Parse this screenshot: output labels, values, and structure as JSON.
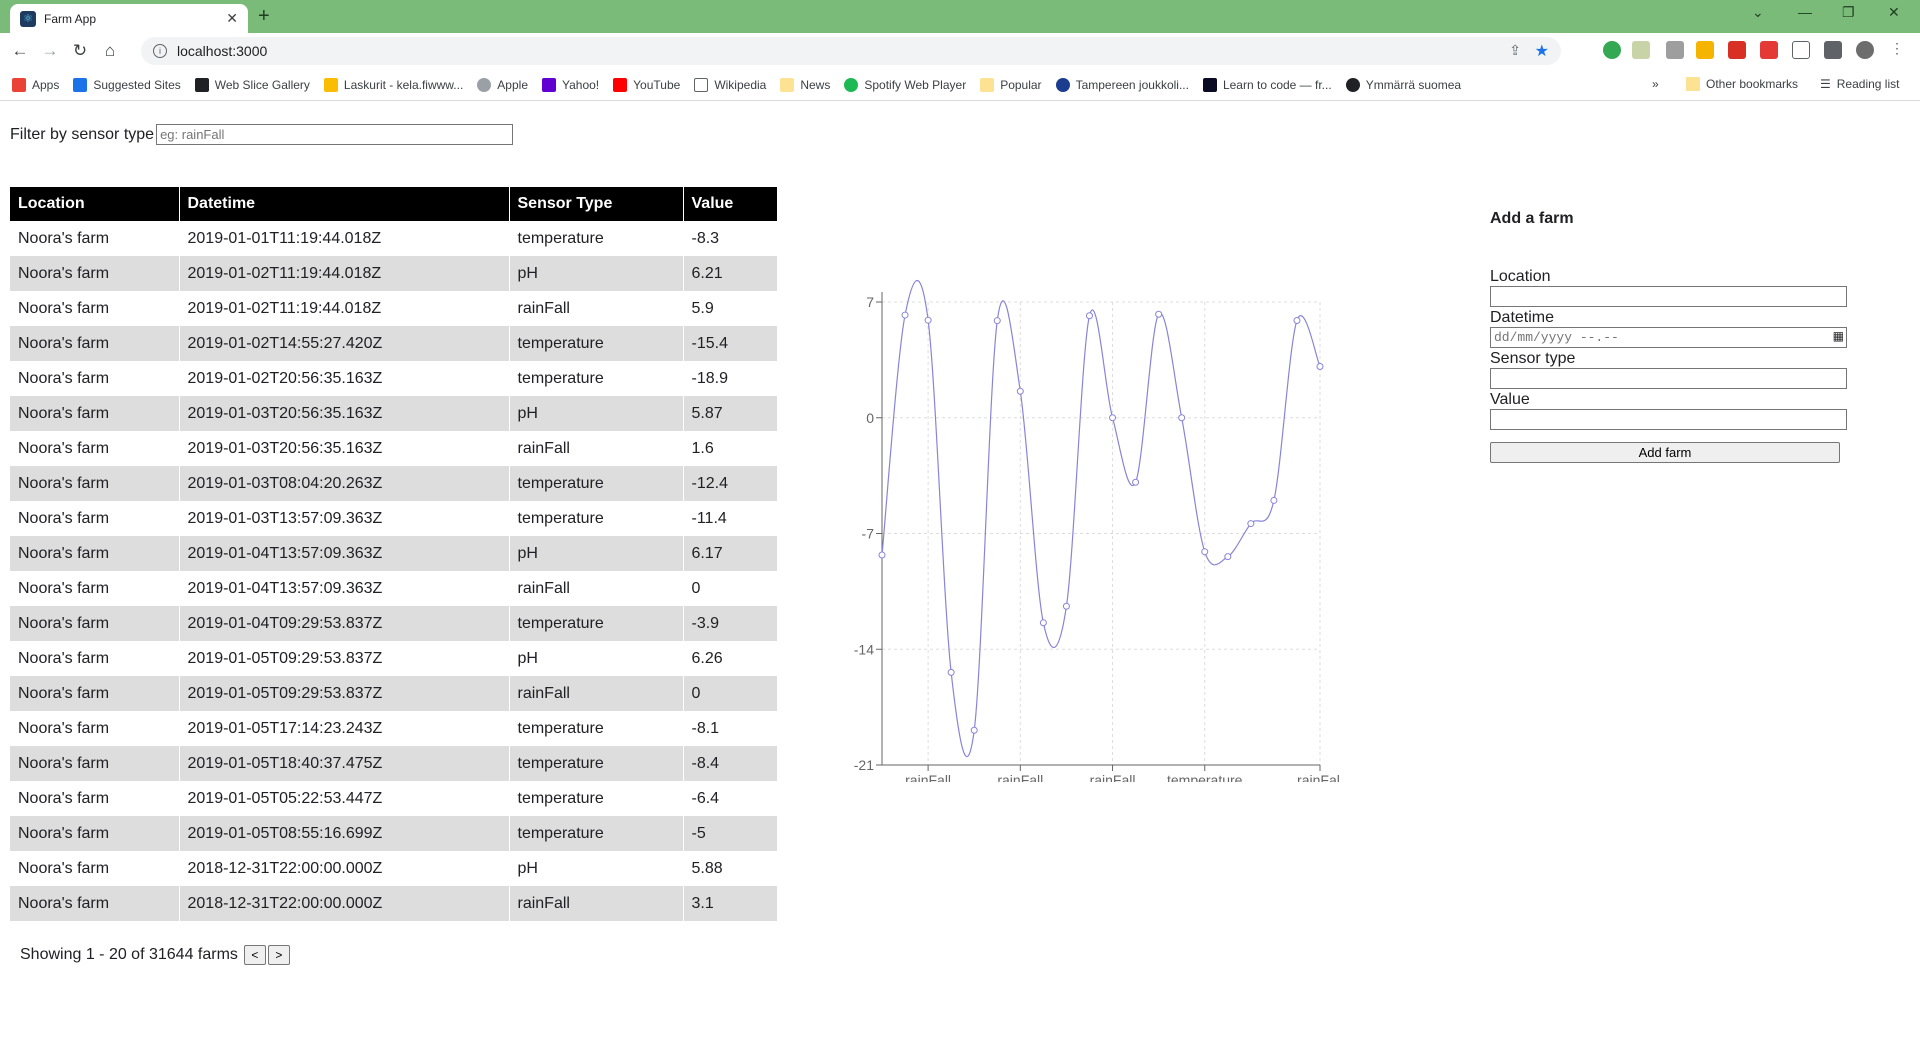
{
  "browser": {
    "tab_title": "Farm App",
    "url": "localhost:3000",
    "bookmarks": [
      "Apps",
      "Suggested Sites",
      "Web Slice Gallery",
      "Laskurit - kela.fiwww...",
      "Apple",
      "Yahoo!",
      "YouTube",
      "Wikipedia",
      "News",
      "Spotify Web Player",
      "Popular",
      "Tampereen joukkoli...",
      "Learn to code — fr...",
      "Ymmärrä suomea"
    ],
    "other_bookmarks": "Other bookmarks",
    "reading_list": "Reading list"
  },
  "filter": {
    "label": "Filter by sensor type",
    "placeholder": "eg: rainFall"
  },
  "table": {
    "columns": [
      "Location",
      "Datetime",
      "Sensor Type",
      "Value"
    ],
    "rows": [
      [
        "Noora's farm",
        "2019-01-01T11:19:44.018Z",
        "temperature",
        "-8.3"
      ],
      [
        "Noora's farm",
        "2019-01-02T11:19:44.018Z",
        "pH",
        "6.21"
      ],
      [
        "Noora's farm",
        "2019-01-02T11:19:44.018Z",
        "rainFall",
        "5.9"
      ],
      [
        "Noora's farm",
        "2019-01-02T14:55:27.420Z",
        "temperature",
        "-15.4"
      ],
      [
        "Noora's farm",
        "2019-01-02T20:56:35.163Z",
        "temperature",
        "-18.9"
      ],
      [
        "Noora's farm",
        "2019-01-03T20:56:35.163Z",
        "pH",
        "5.87"
      ],
      [
        "Noora's farm",
        "2019-01-03T20:56:35.163Z",
        "rainFall",
        "1.6"
      ],
      [
        "Noora's farm",
        "2019-01-03T08:04:20.263Z",
        "temperature",
        "-12.4"
      ],
      [
        "Noora's farm",
        "2019-01-03T13:57:09.363Z",
        "temperature",
        "-11.4"
      ],
      [
        "Noora's farm",
        "2019-01-04T13:57:09.363Z",
        "pH",
        "6.17"
      ],
      [
        "Noora's farm",
        "2019-01-04T13:57:09.363Z",
        "rainFall",
        "0"
      ],
      [
        "Noora's farm",
        "2019-01-04T09:29:53.837Z",
        "temperature",
        "-3.9"
      ],
      [
        "Noora's farm",
        "2019-01-05T09:29:53.837Z",
        "pH",
        "6.26"
      ],
      [
        "Noora's farm",
        "2019-01-05T09:29:53.837Z",
        "rainFall",
        "0"
      ],
      [
        "Noora's farm",
        "2019-01-05T17:14:23.243Z",
        "temperature",
        "-8.1"
      ],
      [
        "Noora's farm",
        "2019-01-05T18:40:37.475Z",
        "temperature",
        "-8.4"
      ],
      [
        "Noora's farm",
        "2019-01-05T05:22:53.447Z",
        "temperature",
        "-6.4"
      ],
      [
        "Noora's farm",
        "2019-01-05T08:55:16.699Z",
        "temperature",
        "-5"
      ],
      [
        "Noora's farm",
        "2018-12-31T22:00:00.000Z",
        "pH",
        "5.88"
      ],
      [
        "Noora's farm",
        "2018-12-31T22:00:00.000Z",
        "rainFall",
        "3.1"
      ]
    ]
  },
  "pager": {
    "text": "Showing 1 - 20 of 31644 farms",
    "prev": "<",
    "next": ">"
  },
  "chart_data": {
    "type": "line",
    "x": [
      "temperature",
      "pH",
      "rainFall",
      "temperature",
      "temperature",
      "pH",
      "rainFall",
      "temperature",
      "temperature",
      "pH",
      "rainFall",
      "temperature",
      "pH",
      "rainFall",
      "temperature",
      "temperature",
      "temperature",
      "temperature",
      "pH",
      "rainFall"
    ],
    "values": [
      -8.3,
      6.21,
      5.9,
      -15.4,
      -18.9,
      5.87,
      1.6,
      -12.4,
      -11.4,
      6.17,
      0,
      -3.9,
      6.26,
      0,
      -8.1,
      -8.4,
      -6.4,
      -5,
      5.88,
      3.1
    ],
    "tick_labels": [
      "rainFall",
      "rainFall",
      "rainFall",
      "temperature",
      "rainFall"
    ],
    "tick_indices": [
      2,
      6,
      10,
      14,
      19
    ],
    "yticks": [
      "7",
      "0",
      "-7",
      "-14",
      "-21"
    ],
    "ylim": [
      -21,
      7
    ],
    "line_color": "#8884d8",
    "grid": true
  },
  "form": {
    "title": "Add a farm",
    "location_label": "Location",
    "datetime_label": "Datetime",
    "datetime_placeholder": "dd/mm/yyyy --.--",
    "sensor_label": "Sensor type",
    "value_label": "Value",
    "submit": "Add farm"
  }
}
